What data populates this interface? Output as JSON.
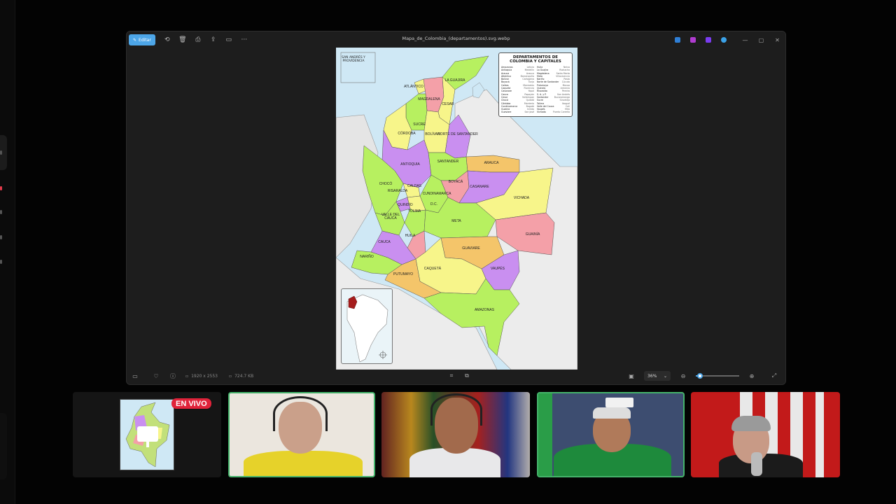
{
  "viewer": {
    "title": "Mapa_de_Colombia_(departamentos).svg.webp",
    "edit_label": "Editar",
    "status": {
      "dimensions": "1920 x 2553",
      "filesize": "724.7 KB",
      "zoom": "36%",
      "zoom_level": 0.1
    },
    "colors": {
      "accent": "#4da6e8"
    }
  },
  "map": {
    "legend_title": "DEPARTAMENTOS DE COLOMBIA Y CAPITALES",
    "legend_left": [
      [
        "Amazonas",
        "Leticia"
      ],
      [
        "Antioquia",
        "Medellín"
      ],
      [
        "Arauca",
        "Arauca"
      ],
      [
        "Atlántico",
        "Barranquilla"
      ],
      [
        "Bolívar",
        "Cartagena"
      ],
      [
        "Boyacá",
        "Tunja"
      ],
      [
        "Caldas",
        "Manizales"
      ],
      [
        "Caquetá",
        "Florencia"
      ],
      [
        "Casanare",
        "Yopal"
      ],
      [
        "Cauca",
        "Popayán"
      ],
      [
        "Cesar",
        "Valledupar"
      ],
      [
        "Chocó",
        "Quibdó"
      ],
      [
        "Córdoba",
        "Montería"
      ],
      [
        "Cundinamarca",
        "Bogotá"
      ],
      [
        "Guainía",
        "Inírida"
      ],
      [
        "Guaviare",
        "San José"
      ]
    ],
    "legend_right": [
      [
        "Huila",
        "Neiva"
      ],
      [
        "La Guajira",
        "Riohacha"
      ],
      [
        "Magdalena",
        "Santa Marta"
      ],
      [
        "Meta",
        "Villavicencio"
      ],
      [
        "Nariño",
        "Pasto"
      ],
      [
        "Norte de Santander",
        "Cúcuta"
      ],
      [
        "Putumayo",
        "Mocoa"
      ],
      [
        "Quindío",
        "Armenia"
      ],
      [
        "Risaralda",
        "Pereira"
      ],
      [
        "S. A. y P.",
        "San Andrés"
      ],
      [
        "Santander",
        "Bucaramanga"
      ],
      [
        "Sucre",
        "Sincelejo"
      ],
      [
        "Tolima",
        "Ibagué"
      ],
      [
        "Valle del Cauca",
        "Cali"
      ],
      [
        "Vaupés",
        "Mitú"
      ],
      [
        "Vichada",
        "Puerto Carreño"
      ]
    ],
    "inset_label": "SAN ANDRÉS Y PROVIDENCIA",
    "labels": {
      "la_guajira": "LA GUAJIRA",
      "atlantico": "ATLÁNTICO",
      "magdalena": "MAGDALENA",
      "cesar": "CESAR",
      "sucre": "SUCRE",
      "cordoba": "CÓRDOBA",
      "bolivar": "BOLÍVAR",
      "norte_santander": "NORTE DE SANTANDER",
      "antioquia": "ANTIOQUIA",
      "santander": "SANTANDER",
      "arauca": "ARAUCA",
      "choco": "CHOCÓ",
      "caldas": "CALDAS",
      "risaralda": "RISARALDA",
      "boyaca": "BOYACÁ",
      "casanare": "CASANARE",
      "cundinamarca": "CUNDINAMARCA",
      "quindio": "QUINDÍO",
      "dc": "D.C.",
      "tolima": "TOLIMA",
      "vichada": "VICHADA",
      "valle": "VALLE DEL CAUCA",
      "meta": "META",
      "guainia": "GUAINÍA",
      "huila": "HUILA",
      "cauca": "CAUCA",
      "guaviare": "GUAVIARE",
      "narino": "NARIÑO",
      "vaupes": "VAUPÉS",
      "caqueta": "CAQUETÁ",
      "putumayo": "PUTUMAYO",
      "amazonas": "AMAZONAS"
    }
  },
  "stream": {
    "live_badge": "EN VIVO"
  }
}
